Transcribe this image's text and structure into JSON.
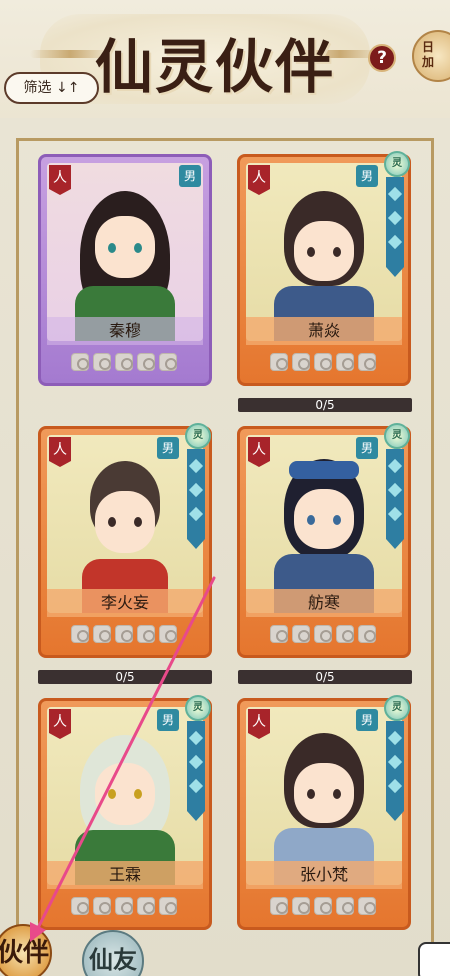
{
  "header": {
    "title": "仙灵伙伴",
    "help_label": "?",
    "corner_badge": "日\n加",
    "filter_label": "筛选 ↓↑"
  },
  "cards": [
    {
      "name": "秦穆",
      "type_tag": "人",
      "gender": "男",
      "rarity": "rare",
      "progress": ""
    },
    {
      "name": "萧焱",
      "type_tag": "人",
      "gender": "男",
      "rarity": "common",
      "progress": "0/5"
    },
    {
      "name": "李火妄",
      "type_tag": "人",
      "gender": "男",
      "rarity": "common",
      "progress": "0/5"
    },
    {
      "name": "舫寒",
      "type_tag": "人",
      "gender": "男",
      "rarity": "common",
      "progress": "0/5"
    },
    {
      "name": "王霖",
      "type_tag": "人",
      "gender": "男",
      "rarity": "common",
      "progress": ""
    },
    {
      "name": "张小梵",
      "type_tag": "人",
      "gender": "男",
      "rarity": "common",
      "progress": ""
    }
  ],
  "bottom_nav": {
    "partner_label": "伙伴",
    "immortal_label": "仙友"
  },
  "colors": {
    "rare_card": "#a47ad0",
    "common_card": "#e5762e",
    "annotation_arrow": "#e84a8a"
  }
}
